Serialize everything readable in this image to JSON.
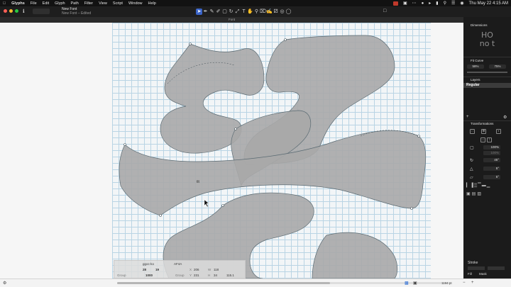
{
  "menubar": {
    "apple": "",
    "app": "Glyphs",
    "items": [
      "File",
      "Edit",
      "Glyph",
      "Path",
      "Filter",
      "View",
      "Script",
      "Window",
      "Help"
    ],
    "clock": "Thu May 22  4:15 AM",
    "status_icons": [
      "user-avatar-icon",
      "camera-icon",
      "dots-icon",
      "wifi-icon",
      "volume-icon",
      "battery-icon",
      "search-icon",
      "control-center-icon",
      "siri-icon"
    ]
  },
  "window": {
    "title": "New Font",
    "subtitle": "New Font – Edited",
    "tab": "Font",
    "traffic_colors": [
      "#ff5f57",
      "#febc2e",
      "#28c840"
    ]
  },
  "toolbar": {
    "tools": [
      "select-tool-icon",
      "draw-tool-icon",
      "pencil-tool-icon",
      "brush-tool-icon",
      "rectangle-tool-icon",
      "rotate-tool-icon",
      "scale-tool-icon",
      "text-tool-icon",
      "hand-tool-icon",
      "zoom-tool-icon",
      "measure-tool-icon",
      "annotation-tool-icon",
      "components-tool-icon",
      "eye-tool-icon",
      "shape-tool-icon"
    ]
  },
  "infobox": {
    "glyph_name": "ggoc-ko",
    "unicode": "AF4A",
    "lsb": "28",
    "rsb": "19",
    "width": "1000",
    "group_label": "Group",
    "x": "206",
    "y": "231",
    "w": "118",
    "h": "34",
    "angle": "115.1",
    "x_label": "X",
    "y_label": "Y",
    "w_label": "W",
    "h_label": "H"
  },
  "sidebar": {
    "dimensions_title": "Dimensions",
    "preview_line1": "HO",
    "preview_line2": "no   t",
    "fit_curve_title": "Fit Curve",
    "fit_curve_values": [
      "58%",
      "75%"
    ],
    "layers_title": "Layers",
    "layer_name": "Regular",
    "transformations_title": "Transformations",
    "scale_value": "100%",
    "scale_value2": "100%",
    "rotate_value": "45°",
    "slant_value": "5°",
    "skew_value": "5°",
    "stroke_title": "Stroke",
    "stroke_fill_label": "Fill",
    "stroke_mask_label": "Mask"
  },
  "statusbar": {
    "zoom": "1194 pt"
  },
  "canvas": {
    "anchor_label": "tlt"
  }
}
